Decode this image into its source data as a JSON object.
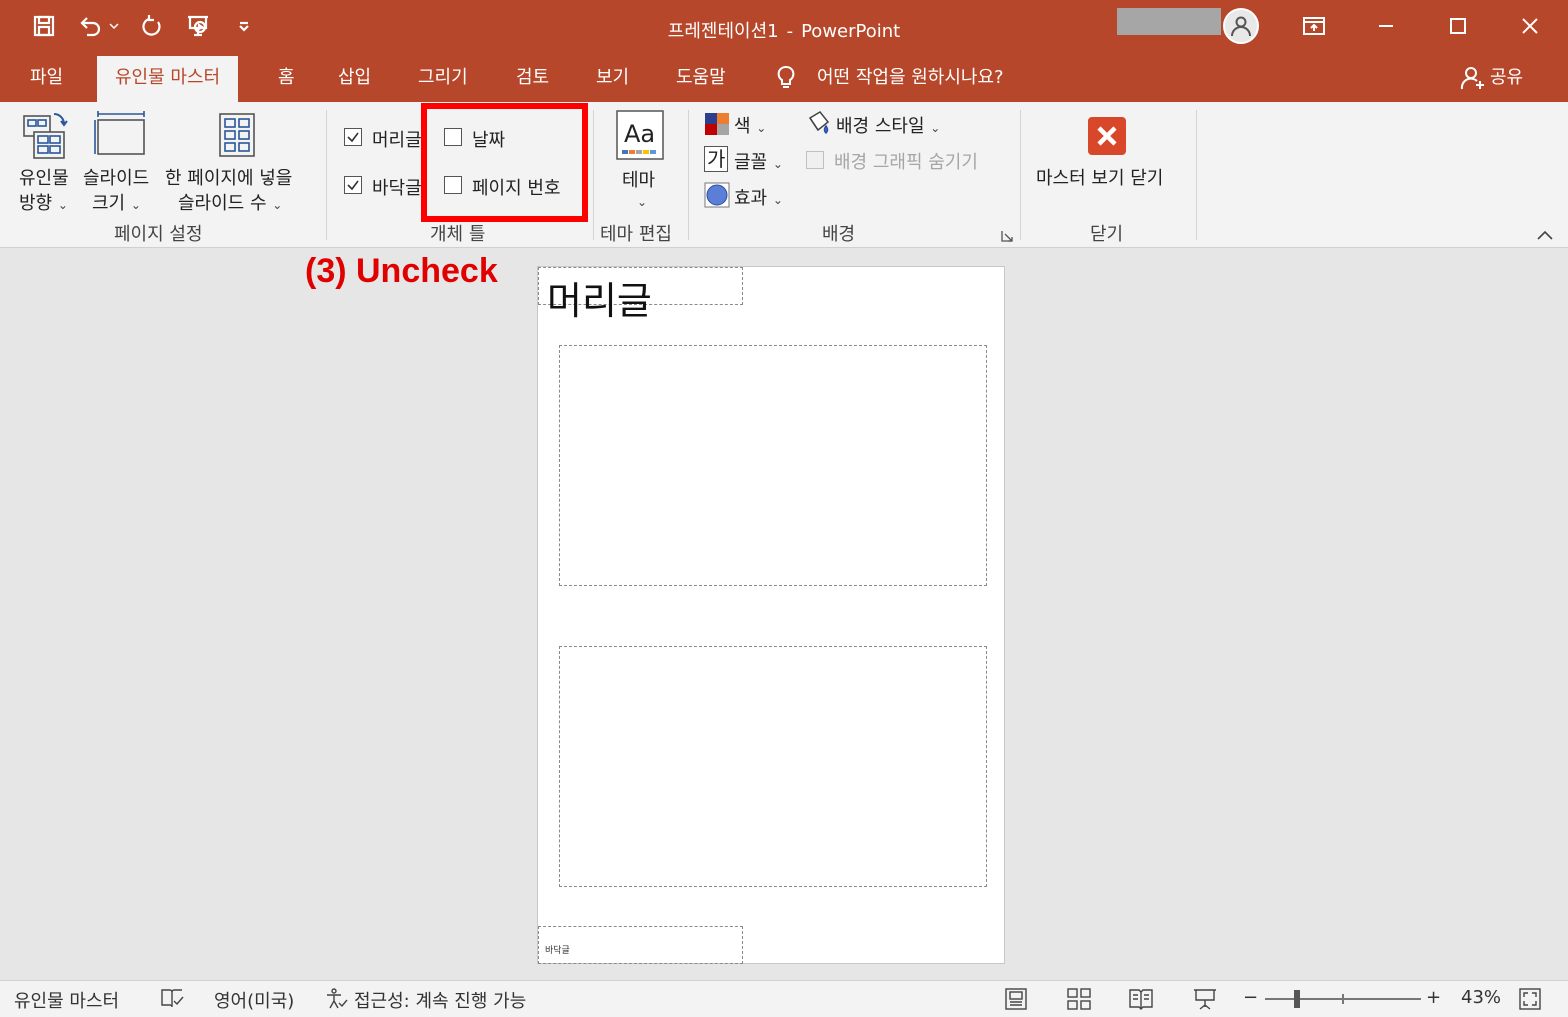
{
  "window": {
    "title": "프레젠테이션1",
    "title_sep": "-",
    "app_name": "PowerPoint"
  },
  "tabs": {
    "file": "파일",
    "handout_master": "유인물 마스터",
    "home": "홈",
    "insert": "삽입",
    "draw": "그리기",
    "review": "검토",
    "view": "보기",
    "help": "도움말",
    "tell_me": "어떤 작업을 원하시나요?",
    "share": "공유"
  },
  "ribbon": {
    "page_setup": {
      "label": "페이지 설정",
      "orientation": [
        "유인물",
        "방향"
      ],
      "slide_size": [
        "슬라이드",
        "크기"
      ],
      "slides_per_page": [
        "한 페이지에 넣을",
        "슬라이드 수"
      ]
    },
    "placeholders": {
      "label": "개체 틀",
      "header": {
        "label": "머리글",
        "checked": true
      },
      "footer": {
        "label": "바닥글",
        "checked": true
      },
      "date": {
        "label": "날짜",
        "checked": false
      },
      "page_number": {
        "label": "페이지 번호",
        "checked": false
      }
    },
    "edit_theme": {
      "label": "테마 편집",
      "theme": "테마"
    },
    "background": {
      "label": "배경",
      "colors": "색",
      "fonts": "글꼴",
      "fonts_icon_text": "가",
      "effects": "효과",
      "background_styles": "배경 스타일",
      "hide_background_graphics": "배경 그래픽 숨기기"
    },
    "close": {
      "label": "닫기",
      "close_master_view": "마스터 보기 닫기"
    }
  },
  "annotation": {
    "text": "(3) Uncheck",
    "color": "#ff0000"
  },
  "slide": {
    "header_text": "머리글",
    "footer_text": "바닥글"
  },
  "statusbar": {
    "view_name": "유인물 마스터",
    "language": "영어(미국)",
    "accessibility": "접근성: 계속 진행 가능",
    "zoom": "43%"
  },
  "colors": {
    "accent": "#b7472a",
    "ribbon_bg": "#f3f3f3",
    "work_bg": "#e6e6e6",
    "close_master_icon": "#d9472b"
  },
  "icons": [
    "save-icon",
    "undo-icon",
    "redo-icon",
    "start-from-beginning-icon",
    "customize-qat-icon",
    "user-avatar-icon",
    "ribbon-display-icon",
    "minimize-icon",
    "maximize-icon",
    "close-icon",
    "lightbulb-icon",
    "share-person-icon"
  ]
}
